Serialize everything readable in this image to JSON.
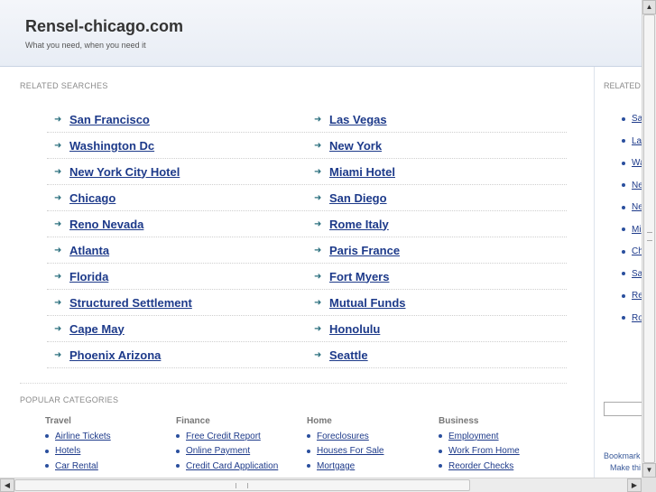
{
  "header": {
    "title": "Rensel-chicago.com",
    "tagline": "What you need, when you need it"
  },
  "related": {
    "title": "RELATED SEARCHES",
    "rows": [
      [
        "San Francisco",
        "Las Vegas"
      ],
      [
        "Washington Dc",
        "New York"
      ],
      [
        "New York City Hotel",
        "Miami Hotel"
      ],
      [
        "Chicago",
        "San Diego"
      ],
      [
        "Reno Nevada",
        "Rome Italy"
      ],
      [
        "Atlanta",
        "Paris France"
      ],
      [
        "Florida",
        "Fort Myers"
      ],
      [
        "Structured Settlement",
        "Mutual Funds"
      ],
      [
        "Cape May",
        "Honolulu"
      ],
      [
        "Phoenix Arizona",
        "Seattle"
      ]
    ]
  },
  "popular": {
    "title": "POPULAR CATEGORIES",
    "columns": [
      {
        "heading": "Travel",
        "items": [
          "Airline Tickets",
          "Hotels",
          "Car Rental"
        ]
      },
      {
        "heading": "Finance",
        "items": [
          "Free Credit Report",
          "Online Payment",
          "Credit Card Application"
        ]
      },
      {
        "heading": "Home",
        "items": [
          "Foreclosures",
          "Houses For Sale",
          "Mortgage"
        ]
      },
      {
        "heading": "Business",
        "items": [
          "Employment",
          "Work From Home",
          "Reorder Checks"
        ]
      }
    ]
  },
  "right_panel": {
    "title": "RELATED",
    "items": [
      "Sa",
      "Las",
      "Wa",
      "Ne",
      "Ne",
      "Mi",
      "Ch",
      "Sa",
      "Re",
      "Ro"
    ],
    "bookmark": "Bookmark",
    "make": "Make thi"
  },
  "scrollbars": {
    "up": "▲",
    "down": "▼",
    "left": "◀",
    "right": "▶"
  },
  "colors": {
    "link": "#1d3a8a",
    "arrow": "#2b6f7e",
    "header_bg": "#e8edf5"
  }
}
